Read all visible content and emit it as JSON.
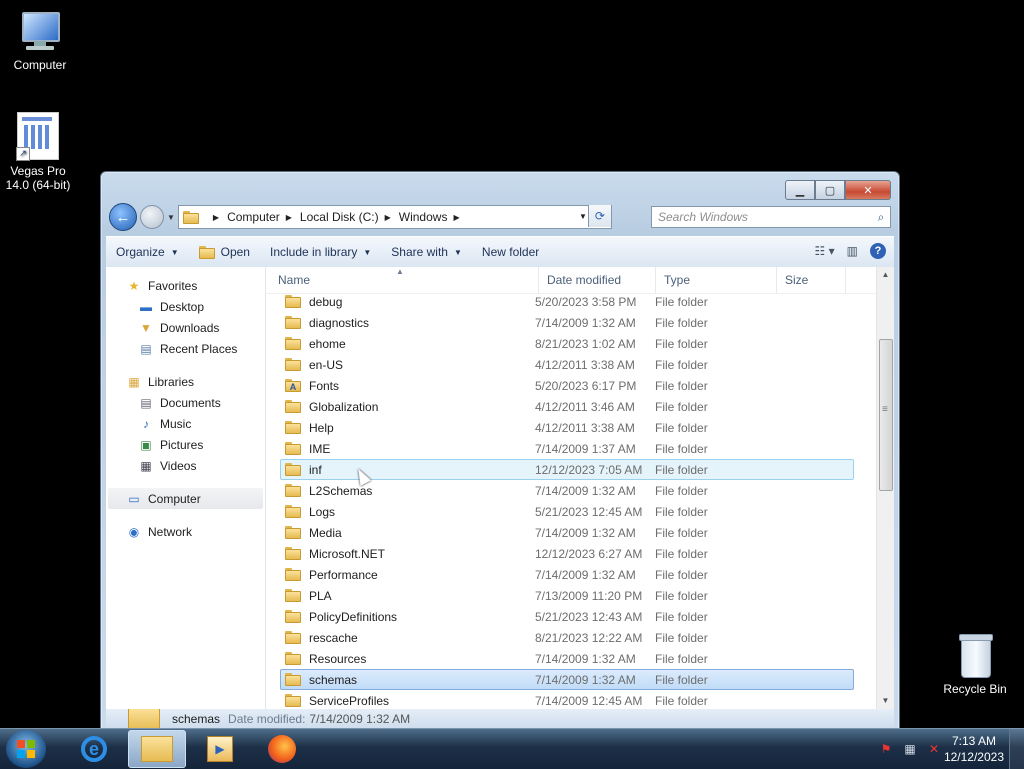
{
  "desktop": {
    "icons": [
      {
        "label": "Computer"
      },
      {
        "label": "Vegas Pro 14.0 (64-bit)"
      },
      {
        "label": "Recycle Bin"
      }
    ]
  },
  "window": {
    "address": [
      "Computer",
      "Local Disk (C:)",
      "Windows"
    ],
    "search_placeholder": "Search Windows",
    "toolbar": {
      "organize": "Organize",
      "open": "Open",
      "include": "Include in library",
      "share": "Share with",
      "new_folder": "New folder"
    },
    "nav": {
      "favorites": "Favorites",
      "favorites_items": [
        "Desktop",
        "Downloads",
        "Recent Places"
      ],
      "libraries": "Libraries",
      "libraries_items": [
        "Documents",
        "Music",
        "Pictures",
        "Videos"
      ],
      "computer": "Computer",
      "network": "Network"
    },
    "columns": {
      "name": "Name",
      "date": "Date modified",
      "type": "Type",
      "size": "Size"
    },
    "rows": [
      {
        "name": "debug",
        "date": "5/20/2023 3:58 PM",
        "type": "File folder"
      },
      {
        "name": "diagnostics",
        "date": "7/14/2009 1:32 AM",
        "type": "File folder"
      },
      {
        "name": "ehome",
        "date": "8/21/2023 1:02 AM",
        "type": "File folder"
      },
      {
        "name": "en-US",
        "date": "4/12/2011 3:38 AM",
        "type": "File folder"
      },
      {
        "name": "Fonts",
        "date": "5/20/2023 6:17 PM",
        "type": "File folder"
      },
      {
        "name": "Globalization",
        "date": "4/12/2011 3:46 AM",
        "type": "File folder"
      },
      {
        "name": "Help",
        "date": "4/12/2011 3:38 AM",
        "type": "File folder"
      },
      {
        "name": "IME",
        "date": "7/14/2009 1:37 AM",
        "type": "File folder"
      },
      {
        "name": "inf",
        "date": "12/12/2023 7:05 AM",
        "type": "File folder"
      },
      {
        "name": "L2Schemas",
        "date": "7/14/2009 1:32 AM",
        "type": "File folder"
      },
      {
        "name": "Logs",
        "date": "5/21/2023 12:45 AM",
        "type": "File folder"
      },
      {
        "name": "Media",
        "date": "7/14/2009 1:32 AM",
        "type": "File folder"
      },
      {
        "name": "Microsoft.NET",
        "date": "12/12/2023 6:27 AM",
        "type": "File folder"
      },
      {
        "name": "Performance",
        "date": "7/14/2009 1:32 AM",
        "type": "File folder"
      },
      {
        "name": "PLA",
        "date": "7/13/2009 11:20 PM",
        "type": "File folder"
      },
      {
        "name": "PolicyDefinitions",
        "date": "5/21/2023 12:43 AM",
        "type": "File folder"
      },
      {
        "name": "rescache",
        "date": "8/21/2023 12:22 AM",
        "type": "File folder"
      },
      {
        "name": "Resources",
        "date": "7/14/2009 1:32 AM",
        "type": "File folder"
      },
      {
        "name": "schemas",
        "date": "7/14/2009 1:32 AM",
        "type": "File folder"
      },
      {
        "name": "ServiceProfiles",
        "date": "7/14/2009 12:45 AM",
        "type": "File folder"
      }
    ],
    "details": {
      "name": "schemas",
      "label": "Date modified:",
      "value": "7/14/2009 1:32 AM"
    }
  },
  "taskbar": {
    "time": "7:13 AM",
    "date": "12/12/2023"
  }
}
